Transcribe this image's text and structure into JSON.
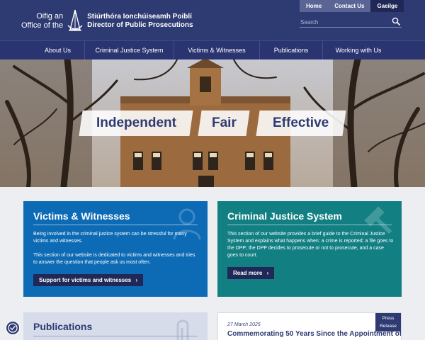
{
  "header": {
    "logo_left": [
      "Oifig an",
      "Office of the"
    ],
    "logo_right": [
      "Stiúrthóra Ionchúiseamh Poiblí",
      "Director of Public Prosecutions"
    ],
    "logo_icon": "scales-emblem-icon",
    "top_links": [
      "Home",
      "Contact Us",
      "Gaeilge"
    ],
    "search_placeholder": "Search",
    "search_icon": "search-icon"
  },
  "nav": {
    "items": [
      "About Us",
      "Criminal Justice System",
      "Victims & Witnesses",
      "Publications",
      "Working with Us"
    ]
  },
  "hero": {
    "tags": [
      "Independent",
      "Fair",
      "Effective"
    ]
  },
  "cards": {
    "victims": {
      "title": "Victims & Witnesses",
      "icon": "person-icon",
      "para1": "Being involved in the criminal justice system can be stressful for many victims and witnesses.",
      "para2": "This section of our website is dedicated to victims and witnesses and tries to answer the question that people ask us most often.",
      "button": "Support for victims and witnesses"
    },
    "cjs": {
      "title": "Criminal Justice System",
      "icon": "gavel-icon",
      "para1": "This section of our website provides a brief guide to the Criminal Justice System and explains what happens when: a crime is reported; a file goes to the DPP; the DPP decides to prosecute or not to prosecute, and a case goes to court.",
      "button": "Read more"
    },
    "publications": {
      "title": "Publications",
      "icon": "paperclip-icon"
    },
    "press": {
      "badge": [
        "Press",
        "Release"
      ],
      "date": "27 March 2025",
      "title": "Commemorating 50 Years Since the Appointment of"
    }
  },
  "colors": {
    "header": "#2e3a72",
    "victims_card": "#0d6bb5",
    "cjs_card": "#127f83",
    "button": "#1f2856"
  }
}
